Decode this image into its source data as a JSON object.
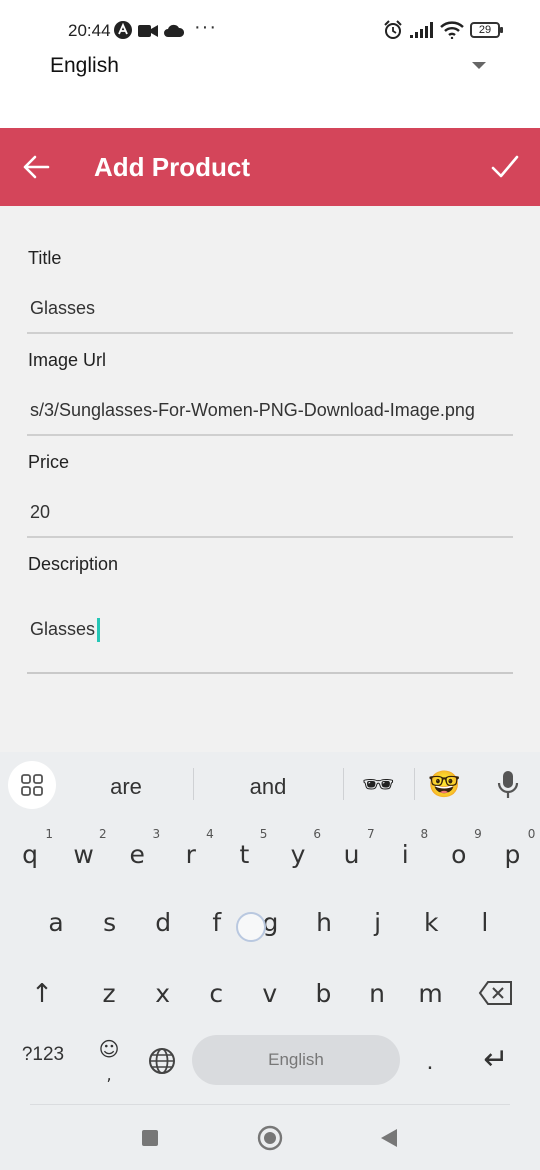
{
  "status_bar": {
    "time": "20:44",
    "battery": "29",
    "more": "···"
  },
  "language_selector": {
    "value": "English"
  },
  "app_bar": {
    "title": "Add Product",
    "color": "#d4455a"
  },
  "form": {
    "fields": [
      {
        "label": "Title",
        "value": "Glasses"
      },
      {
        "label": "Image Url",
        "value": "s/3/Sunglasses-For-Women-PNG-Download-Image.png"
      },
      {
        "label": "Price",
        "value": "20"
      },
      {
        "label": "Description",
        "value": "Glasses"
      }
    ]
  },
  "keyboard": {
    "suggestions": [
      "are",
      "and"
    ],
    "emoji_suggestions": [
      "🕶",
      "🤓"
    ],
    "row1": [
      {
        "key": "q",
        "hint": "1"
      },
      {
        "key": "w",
        "hint": "2"
      },
      {
        "key": "e",
        "hint": "3"
      },
      {
        "key": "r",
        "hint": "4"
      },
      {
        "key": "t",
        "hint": "5"
      },
      {
        "key": "y",
        "hint": "6"
      },
      {
        "key": "u",
        "hint": "7"
      },
      {
        "key": "i",
        "hint": "8"
      },
      {
        "key": "o",
        "hint": "9"
      },
      {
        "key": "p",
        "hint": "0"
      }
    ],
    "row2": [
      "a",
      "s",
      "d",
      "f",
      "g",
      "h",
      "j",
      "k",
      "l"
    ],
    "row3": [
      "z",
      "x",
      "c",
      "v",
      "b",
      "n",
      "m"
    ],
    "symbols_label": "?123",
    "emoji_key_main": "☺",
    "emoji_key_sub": ",",
    "space_label": "English",
    "period": ".",
    "shift_icon": "↑",
    "enter_icon": "↵"
  }
}
